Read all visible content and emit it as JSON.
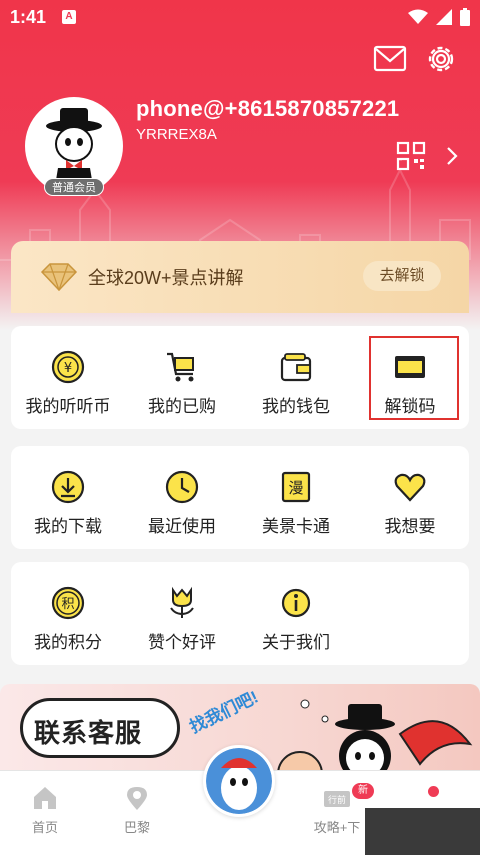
{
  "status_bar": {
    "time": "1:41",
    "notification_letter": "A"
  },
  "profile": {
    "username": "phone@+8615870857221",
    "user_id": "YRRREX8A",
    "member_badge": "普通会员"
  },
  "vip_banner": {
    "text": "全球20W+景点讲解",
    "button": "去解锁"
  },
  "grid_row_1": [
    {
      "label": "我的听听币",
      "icon": "coin-icon"
    },
    {
      "label": "我的已购",
      "icon": "cart-icon"
    },
    {
      "label": "我的钱包",
      "icon": "wallet-icon"
    },
    {
      "label": "解锁码",
      "icon": "ticket-icon"
    }
  ],
  "grid_row_2": [
    {
      "label": "我的下载",
      "icon": "download-icon"
    },
    {
      "label": "最近使用",
      "icon": "clock-icon"
    },
    {
      "label": "美景卡通",
      "icon": "comic-icon"
    },
    {
      "label": "我想要",
      "icon": "heart-icon"
    }
  ],
  "grid_row_3": [
    {
      "label": "我的积分",
      "icon": "points-icon"
    },
    {
      "label": "赞个好评",
      "icon": "tulip-icon"
    },
    {
      "label": "关于我们",
      "icon": "info-icon"
    }
  ],
  "service_banner": {
    "title": "联系客服",
    "subtitle": "找我们吧!"
  },
  "tab_bar": {
    "tabs": [
      {
        "label": "首页",
        "icon": "home-icon"
      },
      {
        "label": "巴黎",
        "icon": "location-icon"
      },
      {
        "label": "攻略+下",
        "icon": "guide-icon"
      }
    ],
    "new_badge": "新",
    "guide_icon_text": "行前"
  },
  "colors": {
    "brand_red": "#ef3b55",
    "accent_yellow": "#fbe34a",
    "highlight_border": "#e0322f"
  }
}
